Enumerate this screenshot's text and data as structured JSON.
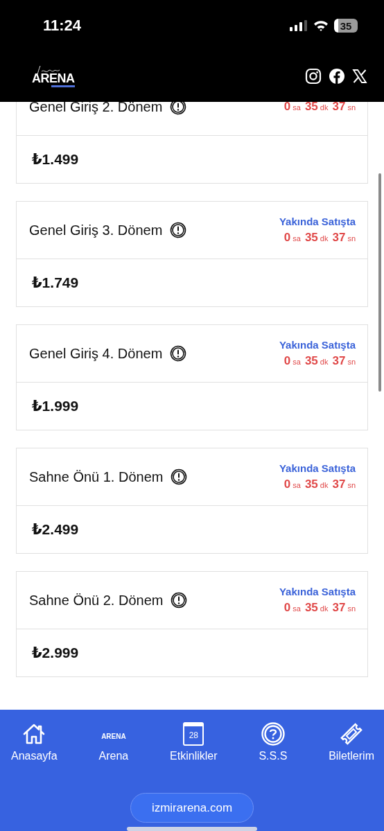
{
  "status_bar": {
    "time": "11:24",
    "battery": "35"
  },
  "header": {
    "logo_text": "ARENA"
  },
  "tickets": [
    {
      "title": "Genel Giriş 2. Dönem",
      "price": "₺1.499",
      "timer": [
        {
          "value": "0",
          "unit": "sa"
        },
        {
          "value": "35",
          "unit": "dk"
        },
        {
          "value": "37",
          "unit": "sn"
        }
      ]
    },
    {
      "title": "Genel Giriş 3. Dönem",
      "status": "Yakında Satışta",
      "price": "₺1.749",
      "timer": [
        {
          "value": "0",
          "unit": "sa"
        },
        {
          "value": "35",
          "unit": "dk"
        },
        {
          "value": "37",
          "unit": "sn"
        }
      ]
    },
    {
      "title": "Genel Giriş 4. Dönem",
      "status": "Yakında Satışta",
      "price": "₺1.999",
      "timer": [
        {
          "value": "0",
          "unit": "sa"
        },
        {
          "value": "35",
          "unit": "dk"
        },
        {
          "value": "37",
          "unit": "sn"
        }
      ]
    },
    {
      "title": "Sahne Önü 1. Dönem",
      "status": "Yakında Satışta",
      "price": "₺2.499",
      "timer": [
        {
          "value": "0",
          "unit": "sa"
        },
        {
          "value": "35",
          "unit": "dk"
        },
        {
          "value": "37",
          "unit": "sn"
        }
      ]
    },
    {
      "title": "Sahne Önü 2. Dönem",
      "status": "Yakında Satışta",
      "price": "₺2.999",
      "timer": [
        {
          "value": "0",
          "unit": "sa"
        },
        {
          "value": "35",
          "unit": "dk"
        },
        {
          "value": "37",
          "unit": "sn"
        }
      ]
    }
  ],
  "bottom_nav": [
    {
      "kind": "home",
      "label": "Anasayfa"
    },
    {
      "kind": "logo",
      "label": "Arena",
      "icon_text": "ARENA"
    },
    {
      "kind": "calendar",
      "label": "Etkinlikler",
      "icon_text": "28"
    },
    {
      "kind": "help",
      "label": "S.S.S"
    },
    {
      "kind": "ticket",
      "label": "Biletlerim"
    }
  ],
  "site_button": "izmirarena.com"
}
